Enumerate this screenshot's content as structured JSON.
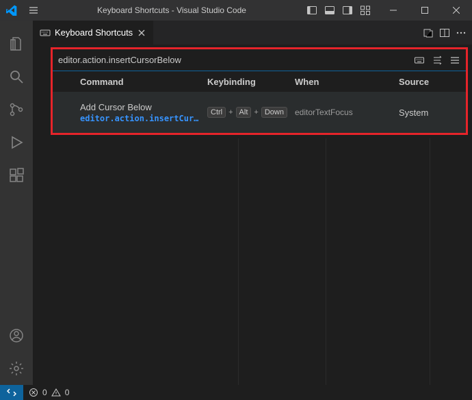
{
  "titlebar": {
    "title": "Keyboard Shortcuts - Visual Studio Code"
  },
  "tab": {
    "label": "Keyboard Shortcuts"
  },
  "search": {
    "value": "editor.action.insertCursorBelow"
  },
  "columns": {
    "command": "Command",
    "keybinding": "Keybinding",
    "when": "When",
    "source": "Source"
  },
  "row": {
    "command_name": "Add Cursor Below",
    "command_id": "editor.action.insertCursor…",
    "keys": {
      "k1": "Ctrl",
      "k2": "Alt",
      "k3": "Down"
    },
    "key_sep": "+",
    "when": "editorTextFocus",
    "source": "System"
  },
  "status": {
    "errors": "0",
    "warnings": "0"
  }
}
